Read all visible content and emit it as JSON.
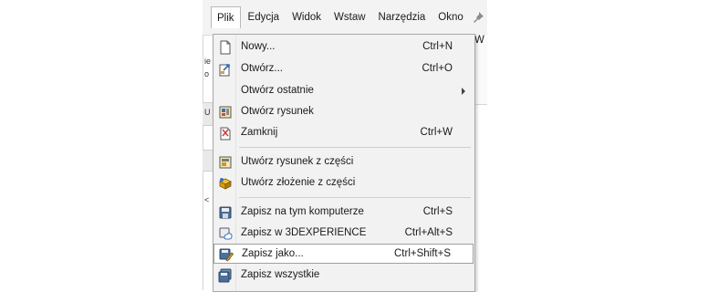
{
  "menubar": {
    "items": [
      "Plik",
      "Edycja",
      "Widok",
      "Wstaw",
      "Narzędzia",
      "Okno"
    ]
  },
  "background": {
    "left_glyphs": [
      "ie",
      "o",
      "U",
      "<"
    ],
    "right_glyph": "W"
  },
  "menu": {
    "items": [
      {
        "label": "Nowy...",
        "shortcut": "Ctrl+N",
        "icon": "new-document-icon"
      },
      {
        "label": "Otwórz...",
        "shortcut": "Ctrl+O",
        "icon": "open-file-icon"
      },
      {
        "label": "Otwórz ostatnie",
        "shortcut": "",
        "icon": "",
        "submenu": true
      },
      {
        "label": "Otwórz rysunek",
        "shortcut": "",
        "icon": "open-drawing-icon"
      },
      {
        "label": "Zamknij",
        "shortcut": "Ctrl+W",
        "icon": "close-document-icon"
      },
      {
        "label": "Utwórz rysunek z części",
        "shortcut": "",
        "icon": "make-drawing-from-part-icon"
      },
      {
        "label": "Utwórz złożenie z części",
        "shortcut": "",
        "icon": "make-assembly-from-part-icon"
      },
      {
        "label": "Zapisz na tym komputerze",
        "shortcut": "Ctrl+S",
        "icon": "save-icon"
      },
      {
        "label": "Zapisz w 3DEXPERIENCE",
        "shortcut": "Ctrl+Alt+S",
        "icon": "save-to-cloud-icon"
      },
      {
        "label": "Zapisz jako...",
        "shortcut": "Ctrl+Shift+S",
        "icon": "save-as-icon",
        "highlighted": true
      },
      {
        "label": "Zapisz wszystkie",
        "shortcut": "",
        "icon": "save-all-icon"
      }
    ]
  },
  "colors": {
    "menu_bg": "#f2f2f2",
    "highlight_bg": "#ffffff",
    "menubar_bg": "#f3f3f3"
  }
}
